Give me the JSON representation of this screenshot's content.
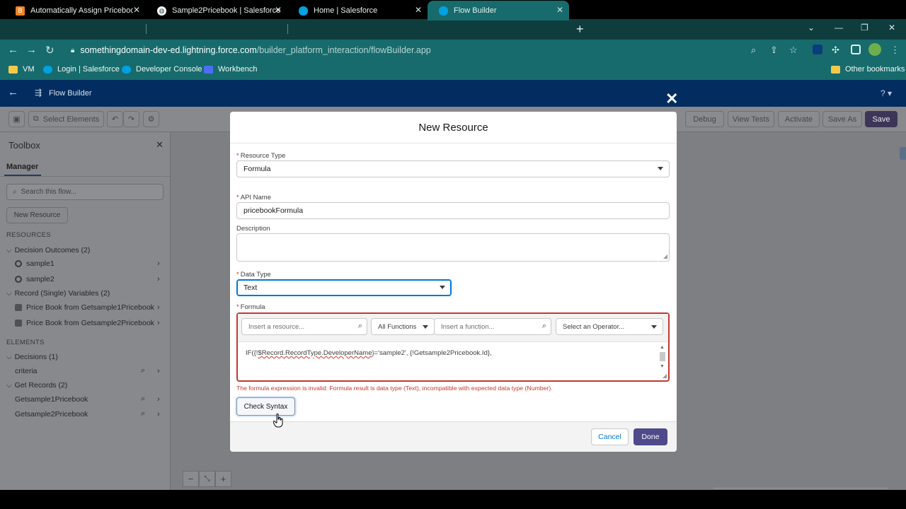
{
  "browser": {
    "tabs": [
      {
        "title": "Automatically Assign Pricebook I",
        "favicon_color": "#f58220",
        "active": false
      },
      {
        "title": "Sample2Pricebook | Salesforce",
        "favicon_color": "#ffffff",
        "active": false
      },
      {
        "title": "Home | Salesforce",
        "favicon_color": "#00a1e0",
        "active": false
      },
      {
        "title": "Flow Builder",
        "favicon_color": "#00a1e0",
        "active": true
      }
    ],
    "url_domain": "somethingdomain-dev-ed.lightning.force.com",
    "url_path": "/builder_platform_interaction/flowBuilder.app",
    "bookmarks": [
      {
        "label": "VM",
        "icon_color": "#f2c94c"
      },
      {
        "label": "Login | Salesforce",
        "icon_color": "#00a1e0"
      },
      {
        "label": "Developer Console",
        "icon_color": "#00a1e0"
      },
      {
        "label": "Workbench",
        "icon_color": "#4c6ef5"
      }
    ],
    "other_bookmarks": "Other bookmarks"
  },
  "app": {
    "header_title": "Flow Builder",
    "help": "?",
    "toolbar": {
      "select_elements": "Select Elements",
      "debug": "Debug",
      "view_tests": "View Tests",
      "activate": "Activate",
      "save_as": "Save As",
      "save": "Save"
    }
  },
  "toolbox": {
    "title": "Toolbox",
    "tab": "Manager",
    "search_placeholder": "Search this flow...",
    "new_resource": "New Resource",
    "resources_header": "RESOURCES",
    "decision_outcomes": "Decision Outcomes (2)",
    "outcomes": [
      "sample1",
      "sample2"
    ],
    "record_vars": "Record (Single) Variables (2)",
    "vars": [
      "Price Book from Getsample1Pricebook",
      "Price Book from Getsample2Pricebook"
    ],
    "elements_header": "ELEMENTS",
    "decisions": "Decisions (1)",
    "decision_items": [
      "criteria"
    ],
    "get_records": "Get Records (2)",
    "get_items": [
      "Getsample1Pricebook",
      "Getsample2Pricebook"
    ]
  },
  "modal": {
    "title": "New Resource",
    "resource_type_label": "Resource Type",
    "resource_type_value": "Formula",
    "api_name_label": "API Name",
    "api_name_value": "pricebookFormula",
    "description_label": "Description",
    "data_type_label": "Data Type",
    "data_type_value": "Text",
    "formula_label": "Formula",
    "insert_resource_placeholder": "Insert a resource...",
    "all_functions": "All Functions",
    "insert_function_placeholder": "Insert a function...",
    "select_operator": "Select an Operator...",
    "formula_pre": "IF({!",
    "formula_err": "$Record.RecordType.DeveloperName",
    "formula_post": "}='sample2', {!Getsample2Pricebook.Id},",
    "error_message": "The formula expression is invalid: Formula result is data type (Text), incompatible with expected data type (Number).",
    "check_syntax": "Check Syntax",
    "cancel": "Cancel",
    "done": "Done"
  },
  "colors": {
    "brand_dark": "#032d60",
    "error": "#c23934",
    "done_button": "#4f4a8b",
    "chrome_teal": "#176b6c"
  }
}
